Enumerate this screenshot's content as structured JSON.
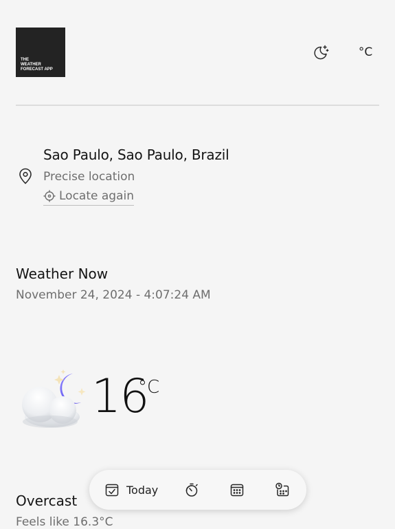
{
  "header": {
    "logo_lines": [
      "THE",
      "WEATHER",
      "FORECAST APP"
    ],
    "theme_icon": "moon-stars-icon",
    "unit_label": "°C"
  },
  "location": {
    "pin_icon": "map-pin-icon",
    "name": "Sao Paulo, Sao Paulo, Brazil",
    "precision": "Precise location",
    "locate_icon": "crosshair-icon",
    "locate_again": "Locate again"
  },
  "weather_now": {
    "title": "Weather Now",
    "datetime": "November 24, 2024 - 4:07:24 AM",
    "icon": "cloud-moon-stars-icon",
    "temperature": "16",
    "temperature_unit": "°C",
    "condition": "Overcast",
    "feels_like": "Feels like 16.3°C"
  },
  "bottom_nav": {
    "items": [
      {
        "icon": "calendar-check-icon",
        "label": "Today",
        "active": true
      },
      {
        "icon": "stopwatch-icon",
        "label": ""
      },
      {
        "icon": "calendar-grid-icon",
        "label": ""
      },
      {
        "icon": "clock-calendar-icon",
        "label": ""
      }
    ]
  }
}
